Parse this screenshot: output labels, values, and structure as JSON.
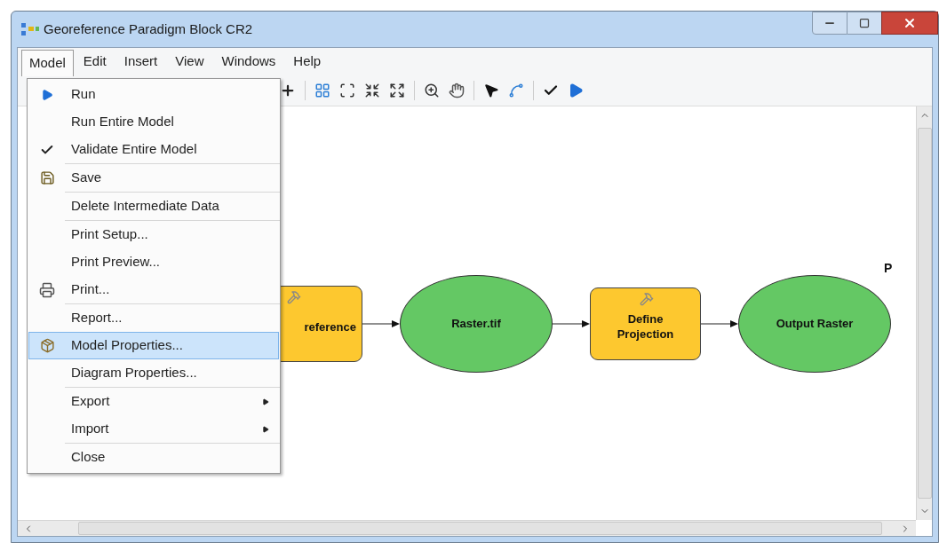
{
  "window": {
    "title": "Georeference Paradigm Block CR2"
  },
  "menubar": [
    {
      "label": "Model",
      "selected": true
    },
    {
      "label": "Edit",
      "selected": false
    },
    {
      "label": "Insert",
      "selected": false
    },
    {
      "label": "View",
      "selected": false
    },
    {
      "label": "Windows",
      "selected": false
    },
    {
      "label": "Help",
      "selected": false
    }
  ],
  "menu": {
    "sections": [
      [
        {
          "label": "Run",
          "kind": "run",
          "selected": false
        },
        {
          "label": "Run Entire Model",
          "kind": "plain",
          "selected": false
        },
        {
          "label": "Validate Entire Model",
          "kind": "validate",
          "selected": false
        }
      ],
      [
        {
          "label": "Save",
          "kind": "save",
          "selected": false
        }
      ],
      [
        {
          "label": "Delete Intermediate Data",
          "kind": "plain",
          "selected": false
        }
      ],
      [
        {
          "label": "Print Setup...",
          "kind": "plain",
          "selected": false
        },
        {
          "label": "Print Preview...",
          "kind": "plain",
          "selected": false
        },
        {
          "label": "Print...",
          "kind": "print",
          "selected": false
        }
      ],
      [
        {
          "label": "Report...",
          "kind": "plain",
          "selected": false
        },
        {
          "label": "Model Properties...",
          "kind": "properties",
          "selected": true
        },
        {
          "label": "Diagram Properties...",
          "kind": "plain",
          "selected": false
        }
      ],
      [
        {
          "label": "Export",
          "kind": "submenu",
          "selected": false
        },
        {
          "label": "Import",
          "kind": "submenu",
          "selected": false
        }
      ],
      [
        {
          "label": "Close",
          "kind": "plain",
          "selected": false
        }
      ]
    ]
  },
  "diagram": {
    "nodes": [
      {
        "label": "reference",
        "kind": "tool"
      },
      {
        "label": "Raster.tif",
        "kind": "data"
      },
      {
        "label": "Define Projection",
        "kind": "tool"
      },
      {
        "label": "Output Raster",
        "kind": "data"
      }
    ],
    "note": "P"
  }
}
